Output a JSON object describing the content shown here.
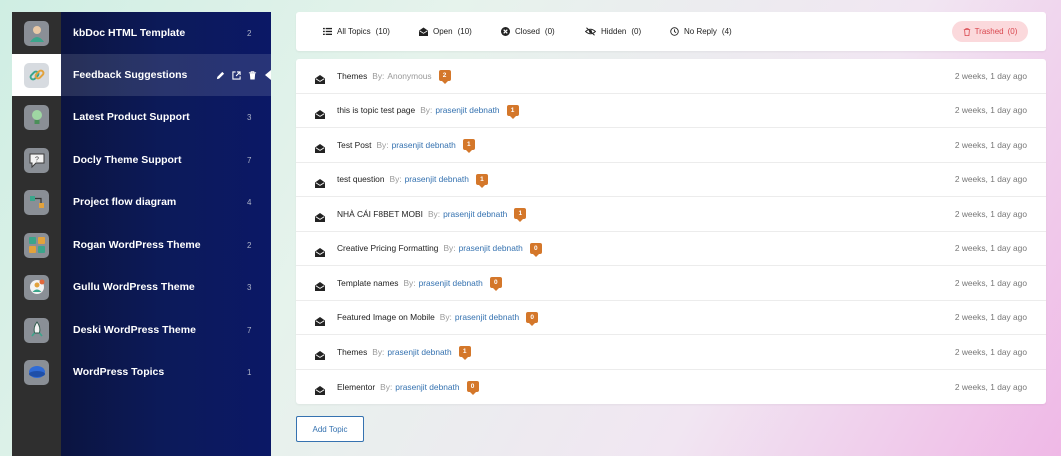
{
  "sidebar": {
    "items": [
      {
        "label": "kbDoc HTML Template",
        "count": "2",
        "icon": "person-icon"
      },
      {
        "label": "Feedback Suggestions",
        "count": "",
        "icon": "link-icon",
        "active": true
      },
      {
        "label": "Latest Product Support",
        "count": "3",
        "icon": "lightbulb-icon"
      },
      {
        "label": "Docly Theme Support",
        "count": "7",
        "icon": "help-bubble-icon"
      },
      {
        "label": "Project flow diagram",
        "count": "4",
        "icon": "flow-icon"
      },
      {
        "label": "Rogan WordPress Theme",
        "count": "2",
        "icon": "grid-icon"
      },
      {
        "label": "Gullu WordPress Theme",
        "count": "3",
        "icon": "gear-person-icon"
      },
      {
        "label": "Deski WordPress Theme",
        "count": "7",
        "icon": "rocket-icon"
      },
      {
        "label": "WordPress Topics",
        "count": "1",
        "icon": "globe-icon"
      }
    ]
  },
  "tabs": {
    "all": "All Topics",
    "all_count": "(10)",
    "open": "Open",
    "open_count": "(10)",
    "closed": "Closed",
    "closed_count": "(0)",
    "hidden": "Hidden",
    "hidden_count": "(0)",
    "no_reply": "No Reply",
    "no_reply_count": "(4)",
    "trashed": "Trashed",
    "trashed_count": "(0)"
  },
  "topics": [
    {
      "title": "Themes",
      "by": "By:",
      "author": "Anonymous",
      "anon": true,
      "replies": "2",
      "time": "2 weeks, 1 day ago"
    },
    {
      "title": "this is topic test page",
      "by": "By:",
      "author": "prasenjit debnath",
      "anon": false,
      "replies": "1",
      "time": "2 weeks, 1 day ago"
    },
    {
      "title": "Test Post",
      "by": "By:",
      "author": "prasenjit debnath",
      "anon": false,
      "replies": "1",
      "time": "2 weeks, 1 day ago"
    },
    {
      "title": "test question",
      "by": "By:",
      "author": "prasenjit debnath",
      "anon": false,
      "replies": "1",
      "time": "2 weeks, 1 day ago"
    },
    {
      "title": "NHÀ CÁI F8BET MOBI",
      "by": "By:",
      "author": "prasenjit debnath",
      "anon": false,
      "replies": "1",
      "time": "2 weeks, 1 day ago"
    },
    {
      "title": "Creative Pricing Formatting",
      "by": "By:",
      "author": "prasenjit debnath",
      "anon": false,
      "replies": "0",
      "time": "2 weeks, 1 day ago"
    },
    {
      "title": "Template names",
      "by": "By:",
      "author": "prasenjit debnath",
      "anon": false,
      "replies": "0",
      "time": "2 weeks, 1 day ago"
    },
    {
      "title": "Featured Image on Mobile",
      "by": "By:",
      "author": "prasenjit debnath",
      "anon": false,
      "replies": "0",
      "time": "2 weeks, 1 day ago"
    },
    {
      "title": "Themes",
      "by": "By:",
      "author": "prasenjit debnath",
      "anon": false,
      "replies": "1",
      "time": "2 weeks, 1 day ago"
    },
    {
      "title": "Elementor",
      "by": "By:",
      "author": "prasenjit debnath",
      "anon": false,
      "replies": "0",
      "time": "2 weeks, 1 day ago"
    }
  ],
  "actions": {
    "add_topic": "Add Topic"
  },
  "colors": {
    "accent": "#3572b0",
    "badge": "#d4772a",
    "trashed_bg": "#fbd9dc",
    "trashed_text": "#d9484f",
    "sidebar_bg": "#0c1a5a"
  }
}
